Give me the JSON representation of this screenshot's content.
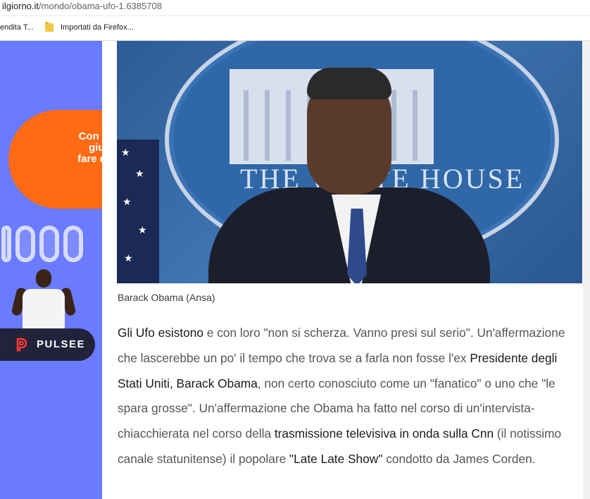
{
  "browser": {
    "url_domain": "ilgiorno.it",
    "url_path": "/mondo/obama-ufo-1.6385708",
    "bookmarks": [
      {
        "label": "endita T..."
      },
      {
        "label": "Importati da Firefox..."
      }
    ]
  },
  "ad": {
    "headline": "Con l'energia giusta puoi fare qualsiasi cosa.",
    "brand": "PULSEE",
    "colors": {
      "background": "#6b7bff",
      "bubble": "#ff6a13",
      "pill": "#22223a"
    }
  },
  "photo": {
    "seal_text": "THE WHITE HOUSE"
  },
  "caption": "Barack Obama (Ansa)",
  "article": {
    "p1": "Gli Ufo esistono",
    "p2": " e con loro \"non si scherza. Vanno presi sul serio\". Un'affermazione che lascerebbe un po' il tempo che trova se a farla non fosse l'ex ",
    "p3": "Presidente degli Stati Uniti, Barack Obama",
    "p4": ", non certo conosciuto come un \"fanatico\" o uno che \"le spara grosse\". Un'affermazione che Obama ha fatto nel corso di un'intervista-chiacchierata nel corso della ",
    "p5": "trasmissione televisiva in onda sulla Cnn",
    "p6": " (il notissimo canale statunitense) il popolare ",
    "p7": "\"Late Late Show\"",
    "p8": " condotto da James Corden."
  }
}
